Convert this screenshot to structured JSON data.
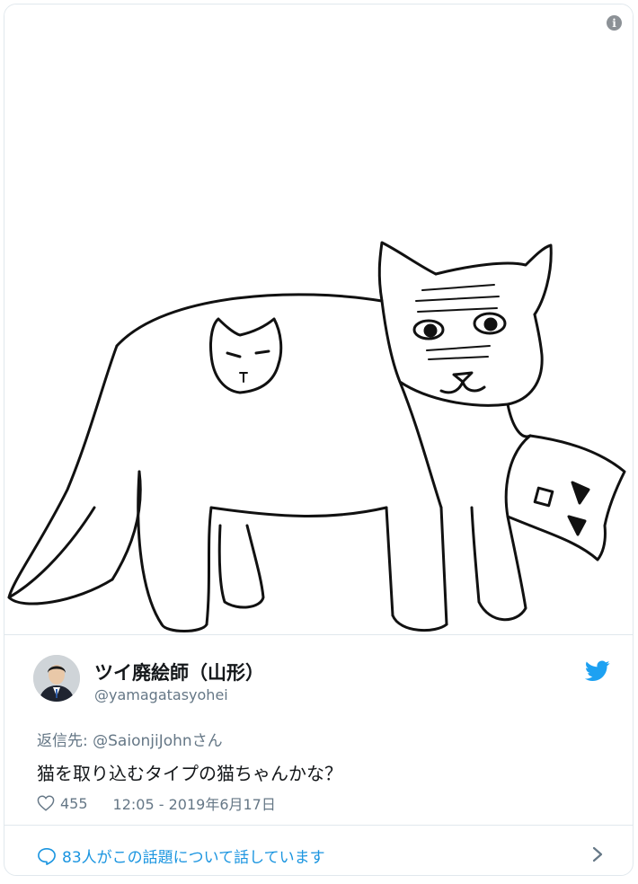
{
  "media": {
    "alt": "猫を取り込む猫のイラスト"
  },
  "icons": {
    "info": "info-icon",
    "bird": "twitter-bird-icon",
    "heart": "heart-icon",
    "bubble": "comment-bubble-icon",
    "chevron": "chevron-right-icon"
  },
  "colors": {
    "accent": "#1da1f2",
    "link": "#1b95e0",
    "muted": "#657786",
    "text": "#14171a"
  },
  "tweet": {
    "author_name": "ツイ廃絵師（山形）",
    "author_handle": "@yamagatasyohei",
    "reply_label": "返信先: ",
    "reply_target": "@SaionjiJohnさん",
    "text": "猫を取り込むタイプの猫ちゃんかな？",
    "likes": "455",
    "timestamp": "12:05 - 2019年6月17日"
  },
  "footer": {
    "conversation": "83人がこの話題について話しています"
  }
}
